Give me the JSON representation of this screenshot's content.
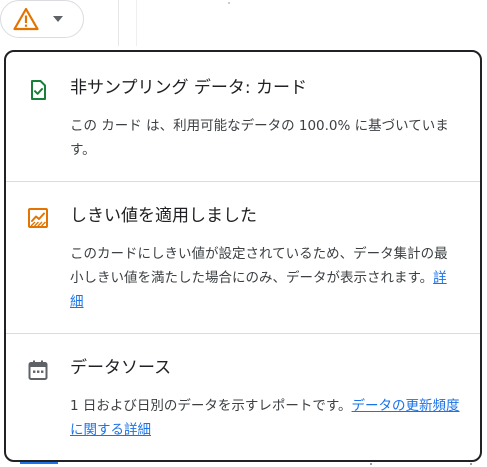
{
  "trigger": {
    "icon": "warning-triangle-icon",
    "caret_icon": "caret-down-icon",
    "warning_color": "#e37400"
  },
  "popup": {
    "sections": [
      {
        "icon": "sampling-check-icon",
        "icon_color": "#188038",
        "title": "非サンプリング データ: カード",
        "body": "この カード は、利用可能なデータの 100.0% に基づいています。"
      },
      {
        "icon": "threshold-chart-icon",
        "icon_color": "#e37400",
        "title": "しきい値を適用しました",
        "body": "このカードにしきい値が設定されているため、データ集計の最小しきい値を満たした場合にのみ、データが表示されます。",
        "link": "詳細"
      },
      {
        "icon": "calendar-icon",
        "icon_color": "#5f6368",
        "title": "データソース",
        "body": "1 日および日別のデータを示すレポートです。",
        "link": "データの更新頻度に関する詳細"
      }
    ]
  },
  "colors": {
    "link": "#1a73e8",
    "border": "#202124",
    "divider": "#dadce0"
  }
}
